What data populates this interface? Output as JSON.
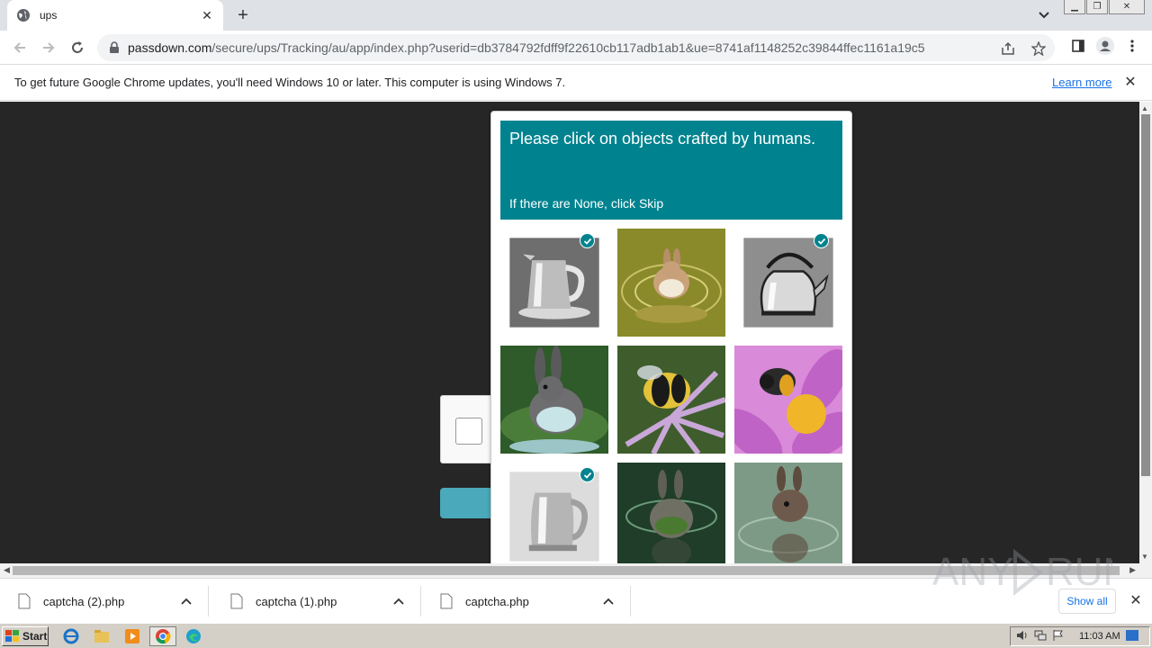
{
  "browser": {
    "tab": {
      "title": "ups"
    },
    "url": {
      "host": "passdown.com",
      "path": "/secure/ups/Tracking/au/app/index.php?userid=db3784792fdff9f22610cb117adb1ab1&ue=8741af1148252c39844ffec1161a19c5"
    },
    "infobar": {
      "message": "To get future Google Chrome updates, you'll need Windows 10 or later. This computer is using Windows 7.",
      "link": "Learn more"
    }
  },
  "captcha": {
    "title": "Please click on objects crafted by humans.",
    "subtitle": "If there are None, click Skip",
    "accent_color": "#00838f",
    "tiles": [
      {
        "subject": "electric kettle",
        "selected": true
      },
      {
        "subject": "rabbit in water",
        "selected": false
      },
      {
        "subject": "stovetop kettle",
        "selected": true
      },
      {
        "subject": "rabbit in water",
        "selected": false
      },
      {
        "subject": "bee on purple flower",
        "selected": false
      },
      {
        "subject": "bee on pink flower",
        "selected": false
      },
      {
        "subject": "electric kettle",
        "selected": true
      },
      {
        "subject": "rabbit in water",
        "selected": false
      },
      {
        "subject": "rabbit in water",
        "selected": false
      }
    ]
  },
  "downloads": {
    "items": [
      {
        "name": "captcha (2).php"
      },
      {
        "name": "captcha (1).php"
      },
      {
        "name": "captcha.php"
      }
    ],
    "show_all": "Show all"
  },
  "taskbar": {
    "start": "Start",
    "clock": "11:03 AM"
  },
  "watermark": "ANY RUN"
}
